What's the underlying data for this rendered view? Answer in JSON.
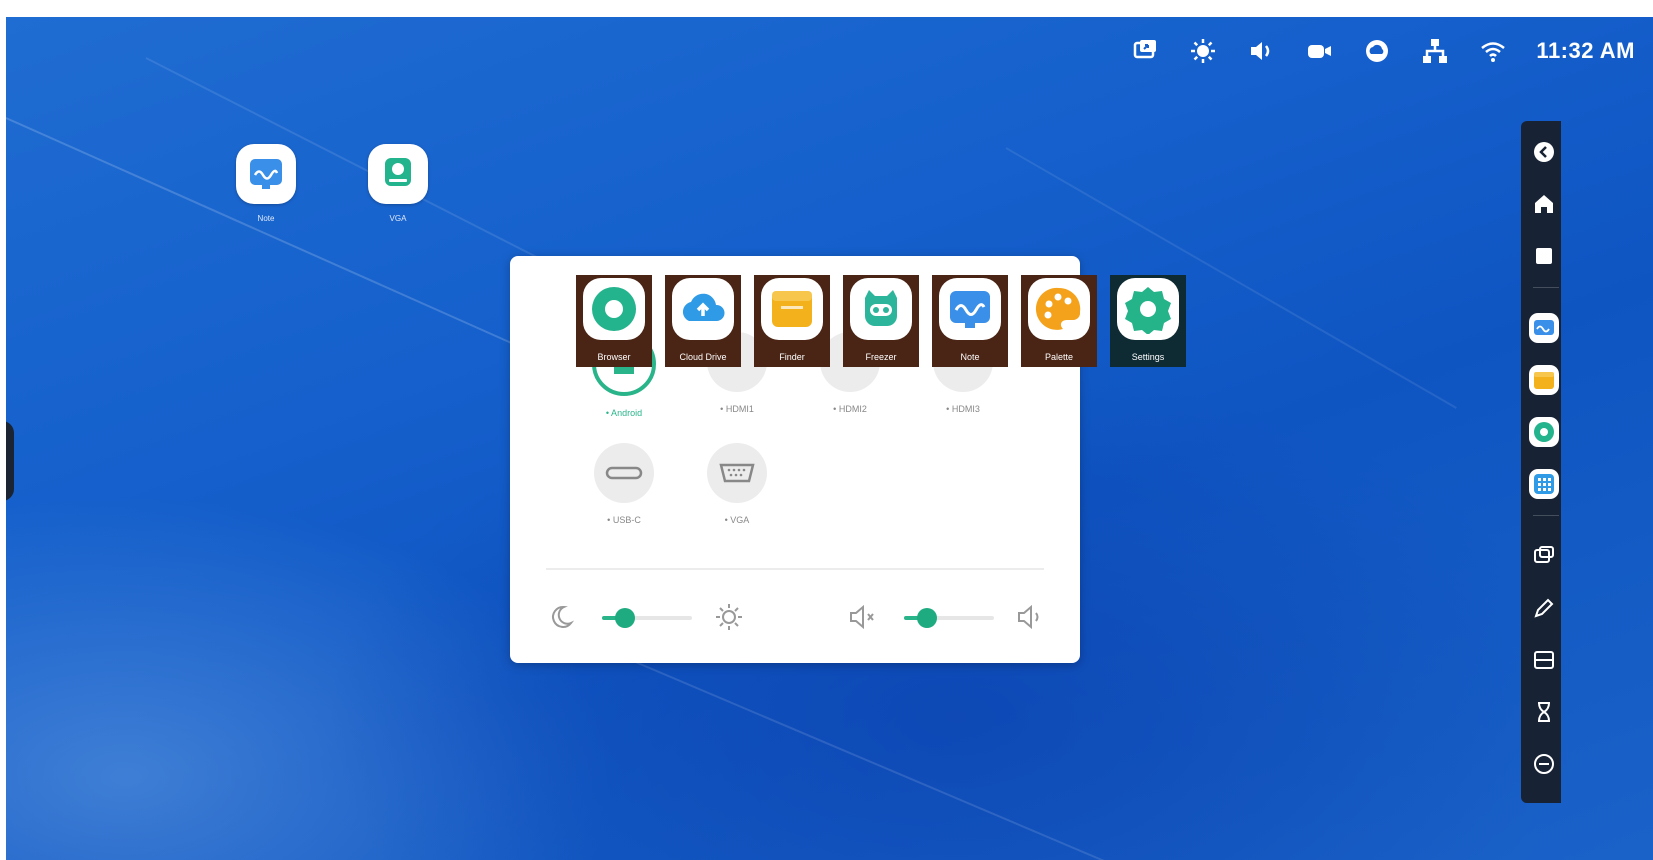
{
  "status_bar": {
    "icons": [
      "screen-share-icon",
      "brightness-icon",
      "volume-icon",
      "camera-icon",
      "cloud-sync-icon",
      "network-icon",
      "wifi-icon"
    ],
    "time": "11:32 AM"
  },
  "desktop": {
    "icons": [
      {
        "name": "note-app-icon",
        "label": "Note"
      },
      {
        "name": "vga-input-icon",
        "label": "VGA"
      }
    ]
  },
  "source_panel": {
    "sources": [
      {
        "name": "Android",
        "label": "• Android",
        "active": true
      },
      {
        "name": "HDMI1",
        "label": "• HDMI1"
      },
      {
        "name": "HDMI2",
        "label": "• HDMI2"
      },
      {
        "name": "HDMI3",
        "label": "• HDMI3"
      },
      {
        "name": "USB-C",
        "label": "• USB-C"
      },
      {
        "name": "VGA",
        "label": "• VGA"
      }
    ],
    "brightness_level": 0.25,
    "volume_level": 0.25
  },
  "app_strip": [
    {
      "label": "Browser",
      "icon": "browser-icon",
      "color": "#23b38d"
    },
    {
      "label": "Cloud Drive",
      "icon": "cloud-drive-icon",
      "color": "#2f9be6"
    },
    {
      "label": "Finder",
      "icon": "finder-icon",
      "color": "#f3b21b"
    },
    {
      "label": "Freezer",
      "icon": "freezer-icon",
      "color": "#2cb59a"
    },
    {
      "label": "Note",
      "icon": "note-icon",
      "color": "#3a8fe8"
    },
    {
      "label": "Palette",
      "icon": "palette-icon",
      "color": "#f4a21c"
    },
    {
      "label": "Settings",
      "icon": "settings-icon",
      "color": "#25b38a"
    }
  ],
  "dock": {
    "items": [
      "back-icon",
      "home-icon",
      "recent-apps-icon",
      "note-icon",
      "finder-icon",
      "browser-icon",
      "all-apps-icon",
      "screen-share-icon",
      "annotate-icon",
      "screenshot-icon",
      "timer-icon",
      "more-icon"
    ]
  },
  "colors": {
    "accent": "#2ab48a",
    "dock_bg": "#172234",
    "wallpaper": "#1560cc"
  }
}
